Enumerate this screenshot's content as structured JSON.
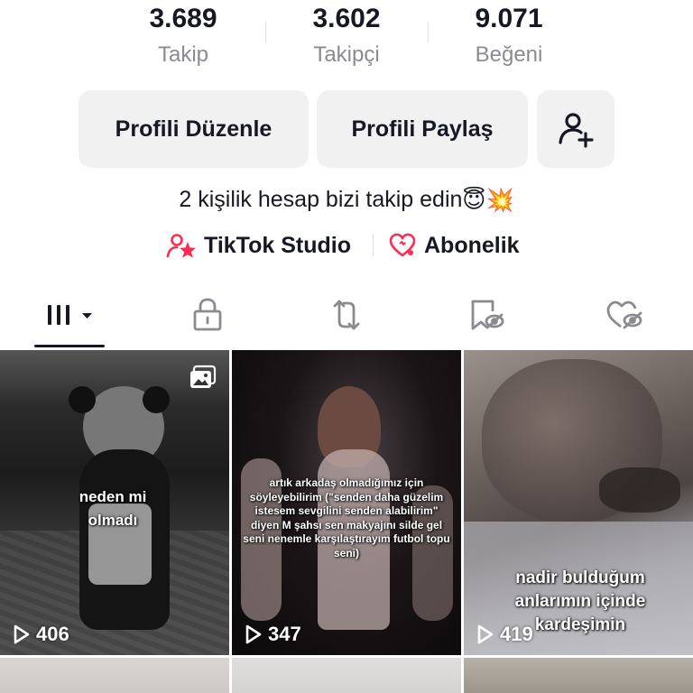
{
  "stats": {
    "following": {
      "value": "3.689",
      "label": "Takip"
    },
    "followers": {
      "value": "3.602",
      "label": "Takipçi"
    },
    "likes": {
      "value": "9.071",
      "label": "Beğeni"
    }
  },
  "actions": {
    "edit_label": "Profili Düzenle",
    "share_label": "Profili Paylaş",
    "add_friend_icon": "person-add-icon"
  },
  "bio": {
    "text": "2 kişilik hesap bizi takip edin",
    "emojis": "😇💥"
  },
  "links": {
    "studio_label": "TikTok Studio",
    "subscription_label": "Abonelik",
    "accent_color": "#fe2c55"
  },
  "tabs": [
    {
      "name": "videos",
      "icon": "grid-icon",
      "active": true
    },
    {
      "name": "private",
      "icon": "lock-icon"
    },
    {
      "name": "reposts",
      "icon": "repost-icon"
    },
    {
      "name": "favorites",
      "icon": "bookmark-hidden-icon"
    },
    {
      "name": "liked",
      "icon": "heart-hidden-icon"
    }
  ],
  "videos": [
    {
      "caption": "neden mi olmadı",
      "views": "406",
      "photo_badge": true
    },
    {
      "caption": "artık arkadaş olmadığımız için söyleyebilirim (\"senden daha güzelim istesem sevgilini senden alabilirim\" diyen M şahsı sen makyajını silde gel seni nenemle karşılaştırayım futbol topu seni)",
      "views": "347"
    },
    {
      "caption": "nadir bulduğum anlarımın içinde kardeşimin",
      "views": "419"
    }
  ]
}
